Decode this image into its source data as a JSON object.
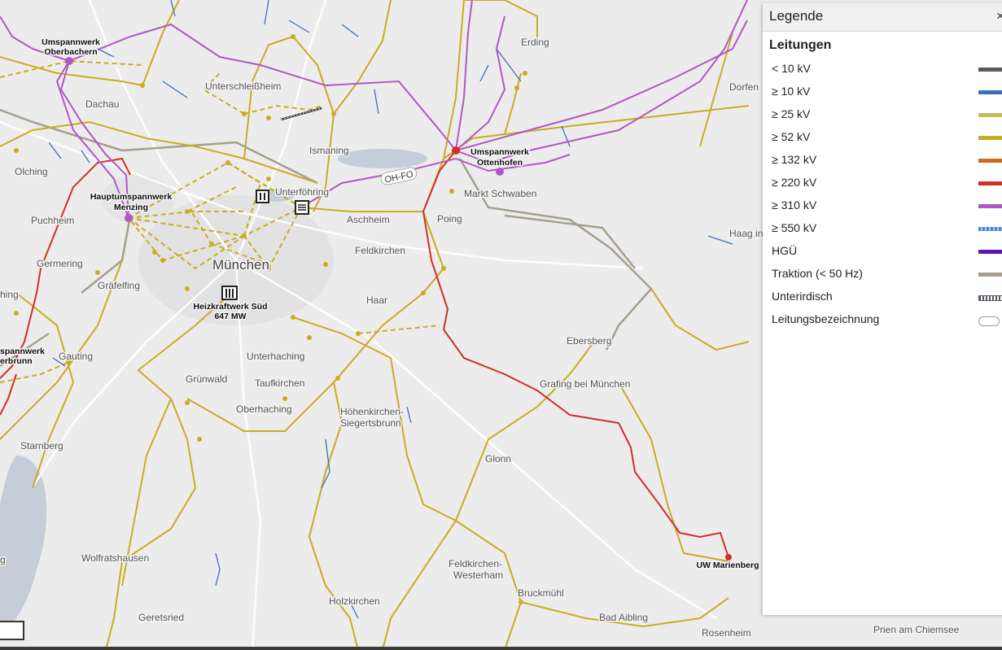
{
  "map": {
    "city": "München",
    "places": [
      "Erding",
      "Dorfen",
      "Unterschleißheim",
      "Dachau",
      "Ismaning",
      "Olching",
      "Unterföhring",
      "Markt Schwaben",
      "Puchheim",
      "Aschheim",
      "Poing",
      "Haag in",
      "Germering",
      "Feldkirchen",
      "Gräfelfing",
      "Haar",
      "Ebersberg",
      "Gauting",
      "Unterhaching",
      "Grünwald",
      "Taufkirchen",
      "Grafing bei München",
      "Oberhaching",
      "Höhenkirchen-",
      "Siegertsbrunn",
      "Starnberg",
      "Glonn",
      "Wolfratshausen",
      "Feldkirchen-",
      "Westerham",
      "Bruckmühl",
      "Holzkirchen",
      "Geretsried",
      "Bad Aibling",
      "Rosenheim",
      "Prien am Chiemsee",
      "hing",
      "g"
    ],
    "stations": [
      "Umspannwerk",
      "Oberbachern",
      "Umspannwerk",
      "Ottenhofen",
      "Hauptumspannwerk",
      "Menzing",
      "Heizkraftwerk Süd",
      "647 MW",
      "UW Marienberg",
      "spannwerk",
      "erbrunn"
    ],
    "line_label": "OH-FO"
  },
  "legend": {
    "title": "Legende",
    "close": "×",
    "section": "Leitungen",
    "items": [
      {
        "label": "< 10 kV",
        "color": "#555a61"
      },
      {
        "label": "≥ 10 kV",
        "color": "#3f6fb5"
      },
      {
        "label": "≥ 25 kV",
        "color": "#c9b75a"
      },
      {
        "label": "≥ 52 kV",
        "color": "#c8ac22"
      },
      {
        "label": "≥ 132 kV",
        "color": "#cf6a1e"
      },
      {
        "label": "≥ 220 kV",
        "color": "#cf3029"
      },
      {
        "label": "≥ 310 kV",
        "color": "#b257c6"
      },
      {
        "label": "≥ 550 kV",
        "color": "#4a86d6"
      },
      {
        "label": "HGÜ",
        "color": "#5e14b3"
      },
      {
        "label": "Traktion (< 50 Hz)",
        "color": "#a49f8e"
      },
      {
        "label": "Unterirdisch",
        "color": "#555a61"
      },
      {
        "label": "Leitungsbezeichnung",
        "color": "#ffffff"
      }
    ]
  }
}
